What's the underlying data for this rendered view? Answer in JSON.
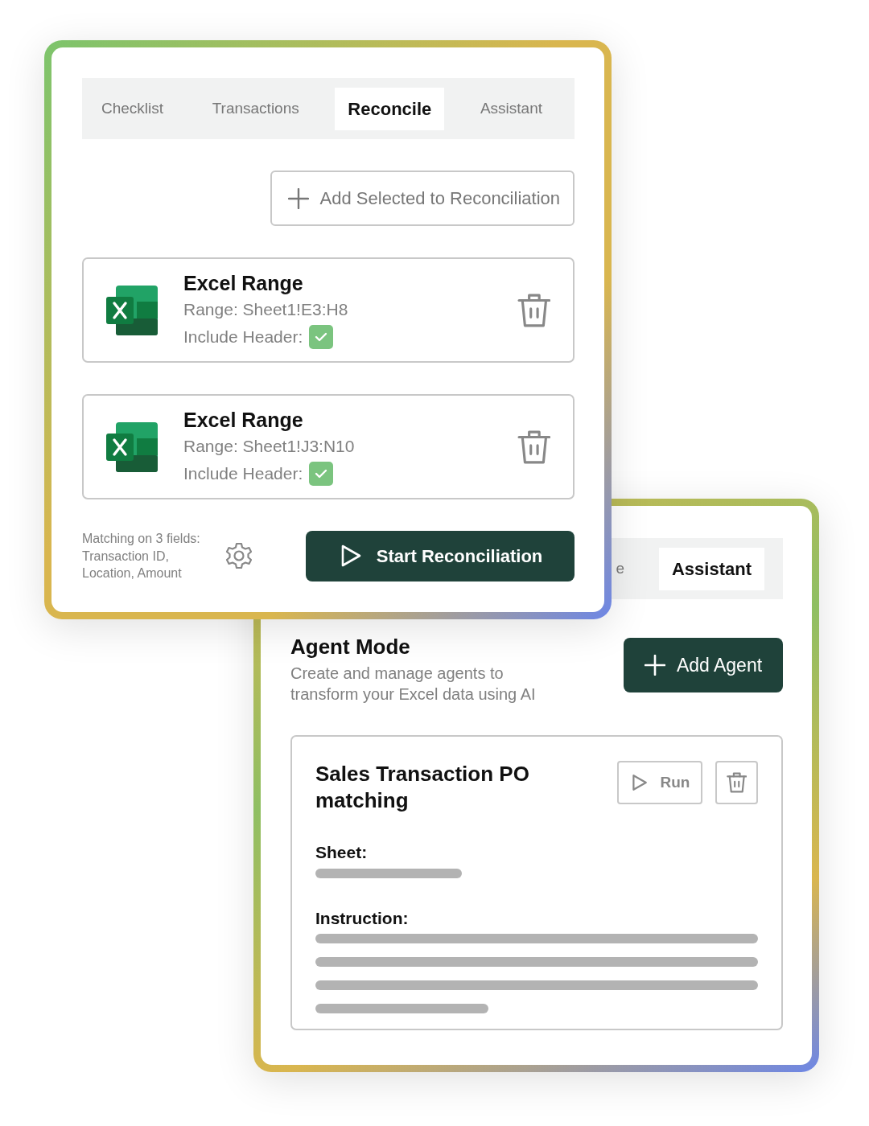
{
  "reconcile_panel": {
    "tabs": [
      {
        "label": "Checklist",
        "selected": false
      },
      {
        "label": "Transactions",
        "selected": false
      },
      {
        "label": "Reconcile",
        "selected": true
      },
      {
        "label": "Assistant",
        "selected": false
      }
    ],
    "add_button": "Add Selected to Reconciliation",
    "ranges": [
      {
        "title": "Excel Range",
        "range": "Range: Sheet1!E3:H8",
        "header_label": "Include Header:",
        "include_header": true
      },
      {
        "title": "Excel Range",
        "range": "Range: Sheet1!J3:N10",
        "header_label": "Include Header:",
        "include_header": true
      }
    ],
    "matching_note": "Matching on 3 fields: Transaction ID, Location, Amount",
    "start_button": "Start Reconciliation"
  },
  "agent_panel": {
    "tabs": [
      {
        "label": "e",
        "selected": false
      },
      {
        "label": "Assistant",
        "selected": true
      }
    ],
    "title": "Agent Mode",
    "description": "Create and manage agents to transform your Excel data using AI",
    "add_button": "Add Agent",
    "agent": {
      "name": "Sales Transaction PO matching",
      "run_button": "Run",
      "sheet_label": "Sheet:",
      "instruction_label": "Instruction:"
    }
  }
}
